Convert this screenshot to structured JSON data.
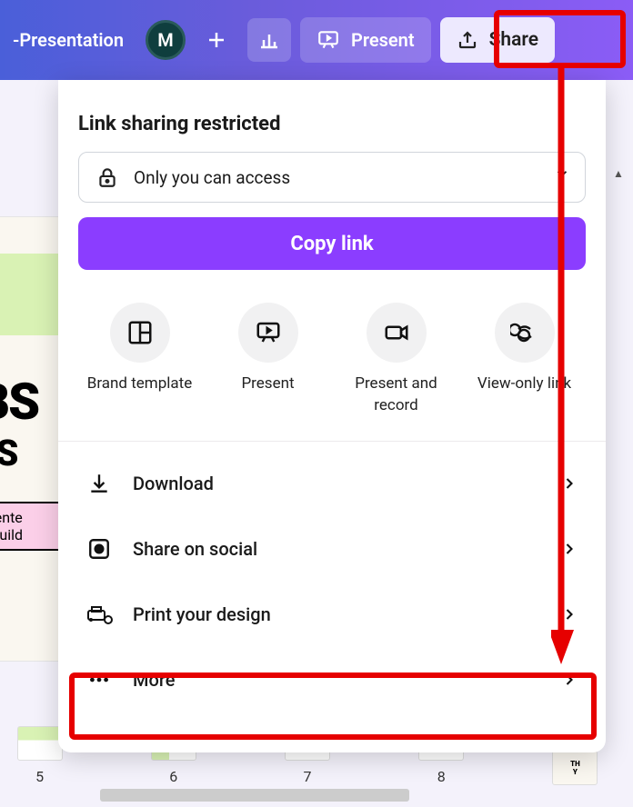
{
  "topbar": {
    "title": "-Presentation",
    "avatar_letter": "M",
    "present_label": "Present",
    "share_label": "Share"
  },
  "share_panel": {
    "title": "Link sharing restricted",
    "access_selector": {
      "icon": "lock-icon",
      "label": "Only you can access"
    },
    "copy_button": "Copy link",
    "options": [
      {
        "icon": "template-icon",
        "label": "Brand template"
      },
      {
        "icon": "present-icon",
        "label": "Present"
      },
      {
        "icon": "record-icon",
        "label": "Present and record"
      },
      {
        "icon": "link-icon",
        "label": "View-only link"
      }
    ],
    "actions": [
      {
        "icon": "download-icon",
        "label": "Download"
      },
      {
        "icon": "social-icon",
        "label": "Share on social"
      },
      {
        "icon": "print-icon",
        "label": "Print your design"
      },
      {
        "icon": "more-icon",
        "label": "More"
      }
    ]
  },
  "slide_peek": {
    "line1": "BS",
    "line2": "ES",
    "pink1": "esente",
    "pink2": "e Build"
  },
  "thumbs": [
    {
      "num": "5"
    },
    {
      "num": "6"
    },
    {
      "num": "7"
    },
    {
      "num": "8"
    }
  ],
  "thumb_far": {
    "text1": "TH",
    "text2": "Y"
  },
  "annotation": {
    "share_highlight": true,
    "more_highlight": true,
    "arrow": true
  },
  "colors": {
    "topbar_grad_a": "#4a5fd9",
    "topbar_grad_b": "#8b5cf6",
    "primary": "#8b3dff",
    "annotation": "#e60000"
  }
}
